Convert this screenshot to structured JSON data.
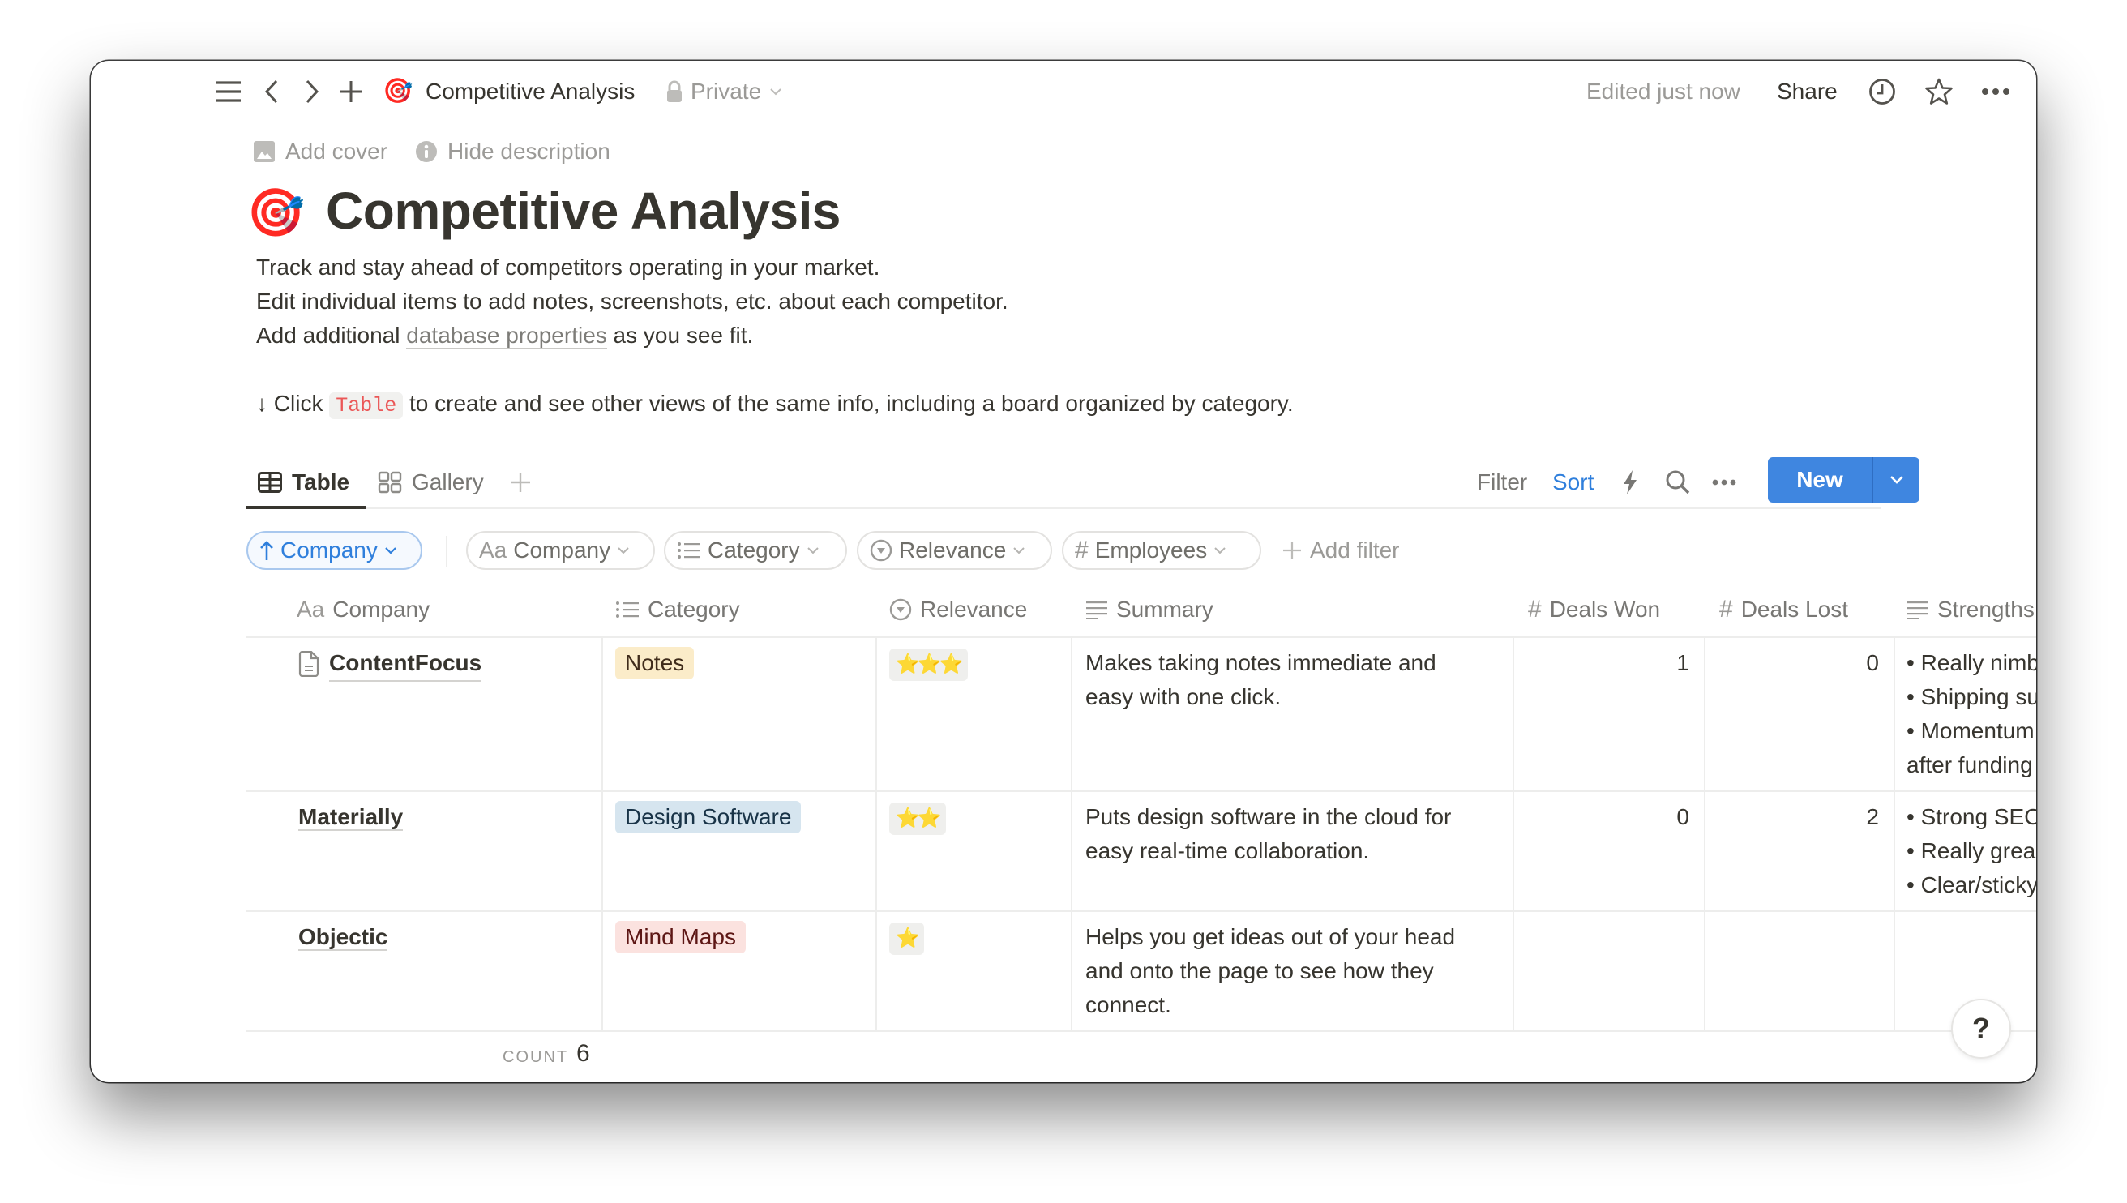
{
  "topbar": {
    "page_emoji": "🎯",
    "breadcrumb_title": "Competitive Analysis",
    "privacy_label": "Private",
    "edited_status": "Edited just now",
    "share_label": "Share"
  },
  "page": {
    "add_cover_label": "Add cover",
    "hide_description_label": "Hide description",
    "title_emoji": "🎯",
    "title": "Competitive Analysis",
    "description": {
      "line1": "Track and stay ahead of competitors operating in your market.",
      "line2": "Edit individual items to add notes, screenshots, etc. about each competitor.",
      "line3_prefix": "Add additional ",
      "line3_link": "database properties",
      "line3_suffix": " as you see fit.",
      "line4_prefix": "↓ Click ",
      "line4_code": "Table",
      "line4_suffix": " to create and see other views of the same info, including a board organized by category."
    }
  },
  "views": {
    "tabs": [
      {
        "label": "Table",
        "active": true
      },
      {
        "label": "Gallery",
        "active": false
      }
    ],
    "toolbar": {
      "filter_label": "Filter",
      "sort_label": "Sort",
      "new_label": "New"
    }
  },
  "filters": {
    "sort_chip": "Company",
    "chips": [
      "Company",
      "Category",
      "Relevance",
      "Employees"
    ],
    "add_filter_label": "Add filter"
  },
  "table": {
    "columns": [
      "Company",
      "Category",
      "Relevance",
      "Summary",
      "Deals Won",
      "Deals Lost",
      "Strengths"
    ],
    "rows": [
      {
        "company": "ContentFocus",
        "category": "Notes",
        "category_color": "#fbecc9",
        "relevance": "⭐⭐⭐",
        "relevance_stars": 3,
        "summary_line1": "Makes taking notes immediate and",
        "summary_line2": "easy with one click.",
        "summary_line3": "",
        "deals_won": "1",
        "deals_lost": "0",
        "strengths": [
          "• Really nimb",
          "• Shipping su",
          "• Momentum",
          "after funding"
        ]
      },
      {
        "company": "Materially",
        "category": "Design Software",
        "category_color": "#d6e5ef",
        "relevance": "⭐⭐",
        "relevance_stars": 2,
        "summary_line1": "Puts design software in the cloud for",
        "summary_line2": "easy real-time collaboration.",
        "summary_line3": "",
        "deals_won": "0",
        "deals_lost": "2",
        "strengths": [
          "• Strong SEO",
          "• Really grea",
          "• Clear/sticky",
          ""
        ]
      },
      {
        "company": "Objectic",
        "category": "Mind Maps",
        "category_color": "#fbe2df",
        "relevance": "⭐",
        "relevance_stars": 1,
        "summary_line1": "Helps you get ideas out of your head",
        "summary_line2": "and onto the page to see how they",
        "summary_line3": "connect.",
        "deals_won": "",
        "deals_lost": "",
        "strengths": [
          "",
          "",
          "",
          ""
        ]
      }
    ],
    "count_label": "COUNT",
    "count_value": "6"
  },
  "help": {
    "label": "?"
  },
  "colors": {
    "accent": "#3f86e0",
    "text": "#37352f",
    "muted": "#9b9a97",
    "code_red": "#eb5757"
  }
}
